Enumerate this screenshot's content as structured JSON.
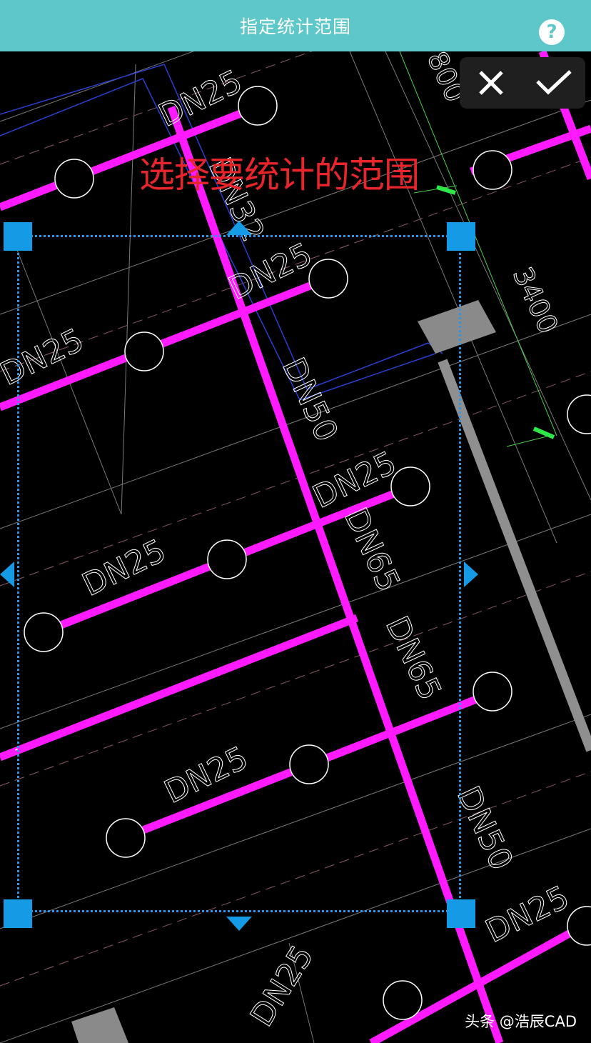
{
  "header": {
    "title": "指定统计范围",
    "help_glyph": "?"
  },
  "toolbar": {
    "cancel_icon": "close-icon",
    "confirm_icon": "check-icon"
  },
  "hint": {
    "text": "选择要统计的范围"
  },
  "drawing": {
    "labels": [
      "DN25",
      "DN25",
      "DN25",
      "DN25",
      "DN25",
      "DN25",
      "DN25",
      "DN25",
      "DN32",
      "DN50",
      "DN65",
      "DN65",
      "DN50",
      "DN25",
      "3400",
      "800"
    ]
  },
  "watermark": {
    "text": "头条 @浩辰CAD"
  },
  "colors": {
    "header": "#5ec7c9",
    "pipe": "#ff1aff",
    "selection": "#2b97e6",
    "hint": "#e8252b",
    "background": "#000000"
  }
}
